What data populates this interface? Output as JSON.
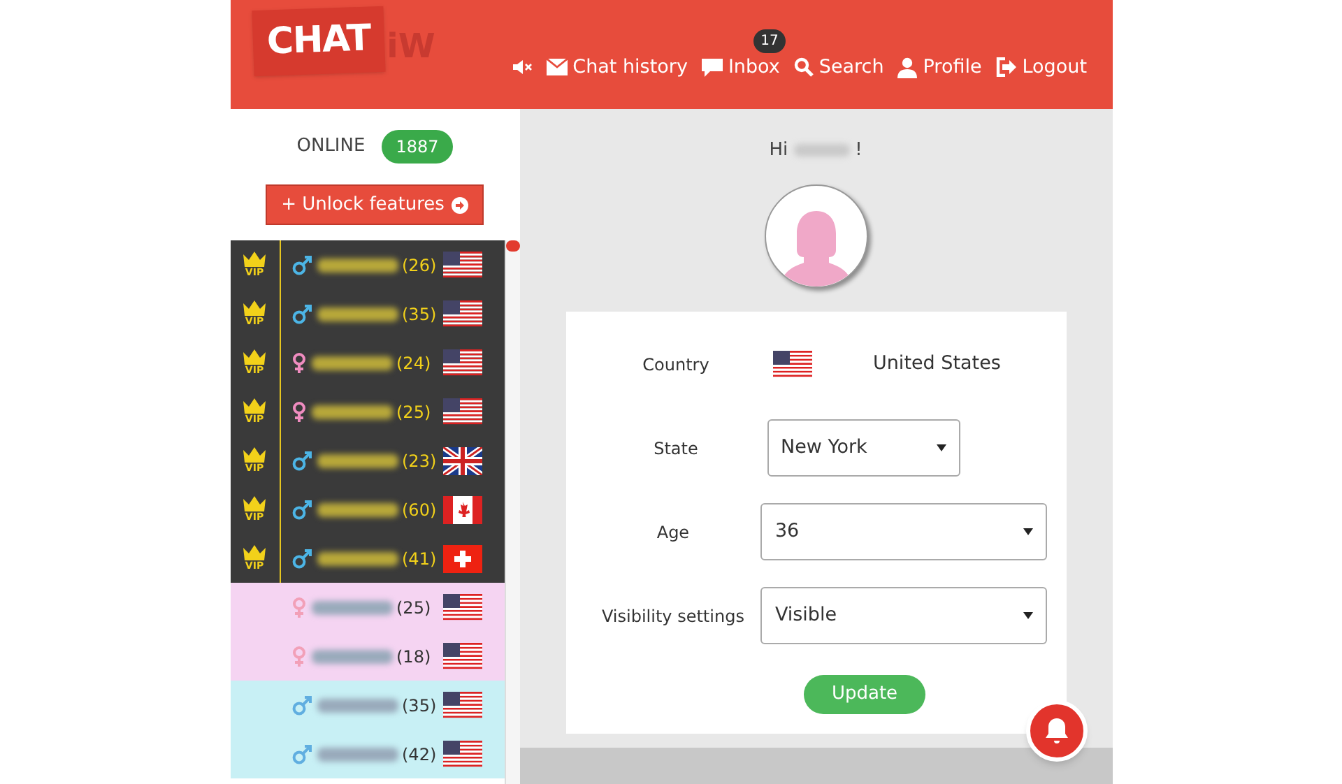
{
  "logo": {
    "main": "CHAT",
    "suffix": "iW"
  },
  "nav": [
    {
      "kind": "mute"
    },
    {
      "kind": "history",
      "label": "Chat history"
    },
    {
      "kind": "inbox",
      "label": "Inbox",
      "badge": "17"
    },
    {
      "kind": "search",
      "label": "Search"
    },
    {
      "kind": "profile",
      "label": "Profile"
    },
    {
      "kind": "logout",
      "label": "Logout"
    }
  ],
  "online": {
    "label": "ONLINE",
    "count": "1887"
  },
  "unlock_button": "+ Unlock features",
  "users": [
    {
      "kind": "vip",
      "badge": "VIP",
      "gender_sign": {
        "kind": "male"
      },
      "age": "(26)",
      "flag": {
        "kind": "us"
      }
    },
    {
      "kind": "vip",
      "badge": "VIP",
      "gender_sign": {
        "kind": "male"
      },
      "age": "(35)",
      "flag": {
        "kind": "us"
      }
    },
    {
      "kind": "vip",
      "badge": "VIP",
      "gender_sign": {
        "kind": "female"
      },
      "age": "(24)",
      "flag": {
        "kind": "us"
      }
    },
    {
      "kind": "vip",
      "badge": "VIP",
      "gender_sign": {
        "kind": "female"
      },
      "age": "(25)",
      "flag": {
        "kind": "us"
      }
    },
    {
      "kind": "vip",
      "badge": "VIP",
      "gender_sign": {
        "kind": "male"
      },
      "age": "(23)",
      "flag": {
        "kind": "gb"
      }
    },
    {
      "kind": "vip",
      "badge": "VIP",
      "gender_sign": {
        "kind": "male"
      },
      "age": "(60)",
      "flag": {
        "kind": "ca"
      }
    },
    {
      "kind": "vip",
      "badge": "VIP",
      "gender_sign": {
        "kind": "male"
      },
      "age": "(41)",
      "flag": {
        "kind": "ch"
      }
    },
    {
      "kind": "regular",
      "gender_sign": {
        "kind": "female"
      },
      "age": "(25)",
      "flag": {
        "kind": "us"
      }
    },
    {
      "kind": "regular",
      "gender_sign": {
        "kind": "female"
      },
      "age": "(18)",
      "flag": {
        "kind": "us"
      }
    },
    {
      "kind": "regular",
      "gender_sign": {
        "kind": "male"
      },
      "age": "(35)",
      "flag": {
        "kind": "us"
      }
    },
    {
      "kind": "regular",
      "gender_sign": {
        "kind": "male"
      },
      "age": "(42)",
      "flag": {
        "kind": "us"
      }
    }
  ],
  "greeting": {
    "prefix": "Hi",
    "suffix": "!"
  },
  "profile_form": [
    {
      "kind": "static",
      "label": "Country",
      "flag": {
        "kind": "us"
      },
      "value": "United States"
    },
    {
      "kind": "select_short",
      "label": "State",
      "value": "New York"
    },
    {
      "kind": "select",
      "label": "Age",
      "value": "36"
    },
    {
      "kind": "select",
      "label": "Visibility settings",
      "value": "Visible"
    }
  ],
  "update_button": "Update"
}
